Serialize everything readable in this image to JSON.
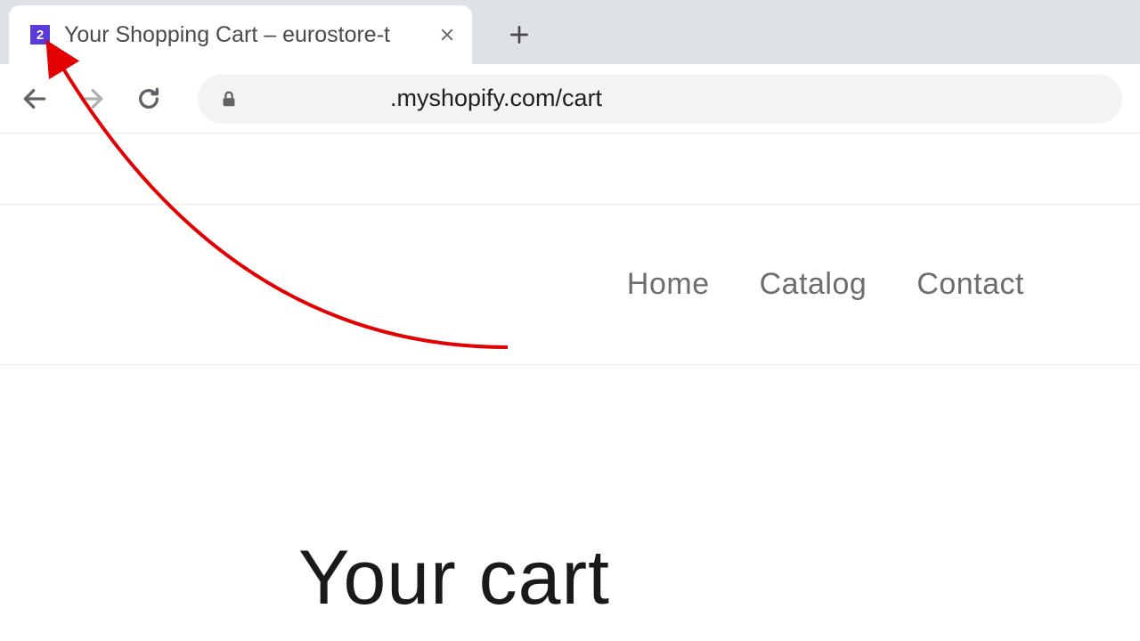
{
  "browser": {
    "tab": {
      "favicon_text": "2",
      "title": "Your Shopping Cart – eurostore-t"
    },
    "url": ".myshopify.com/cart"
  },
  "nav": {
    "items": [
      "Home",
      "Catalog",
      "Contact"
    ]
  },
  "page": {
    "heading": "Your cart"
  }
}
